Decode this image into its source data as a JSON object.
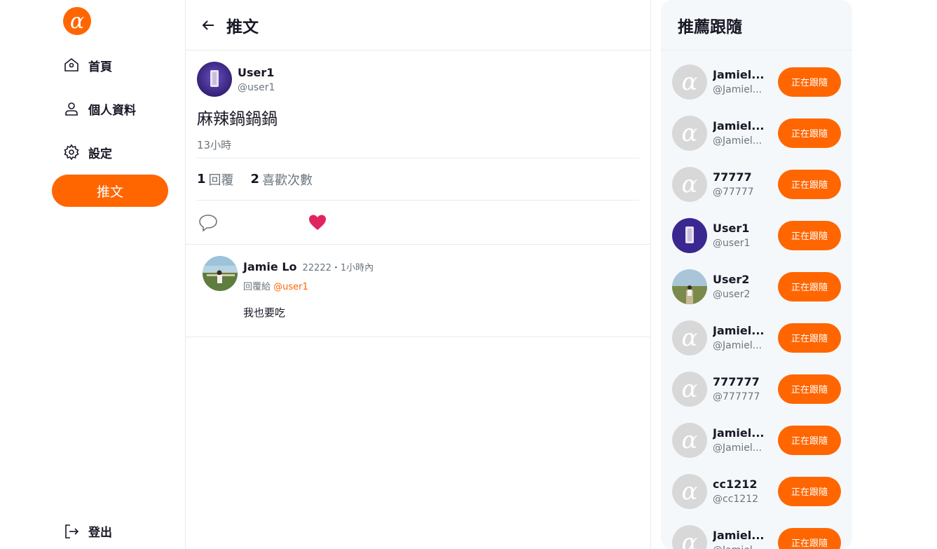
{
  "colors": {
    "brand": "#ff6600",
    "muted": "#6c757d",
    "like": "#e0245e"
  },
  "sidebar": {
    "logo": "alpha-logo",
    "items": [
      {
        "label": "首頁",
        "icon": "home-icon"
      },
      {
        "label": "個人資料",
        "icon": "user-icon"
      },
      {
        "label": "設定",
        "icon": "gear-icon"
      }
    ],
    "tweet_button": "推文",
    "logout": "登出"
  },
  "main": {
    "title": "推文",
    "tweet": {
      "name": "User1",
      "handle": "@user1",
      "text": "麻辣鍋鍋鍋",
      "time": "13小時",
      "reply_count": "1",
      "reply_label": "回覆",
      "like_count": "2",
      "like_label": "喜歡次數"
    },
    "reply": {
      "name": "Jamie Lo",
      "meta": "22222・1小時內",
      "reply_to_label": "回覆給",
      "reply_to_handle": "@user1",
      "text": "我也要吃"
    }
  },
  "right": {
    "title": "推薦跟隨",
    "follow_label": "正在跟隨",
    "users": [
      {
        "name": "Jamiel...",
        "handle": "@Jamiel...",
        "avatar": "default"
      },
      {
        "name": "Jamiel...",
        "handle": "@Jamiel...",
        "avatar": "default"
      },
      {
        "name": "77777",
        "handle": "@77777",
        "avatar": "default"
      },
      {
        "name": "User1",
        "handle": "@user1",
        "avatar": "purple"
      },
      {
        "name": "User2",
        "handle": "@user2",
        "avatar": "photo"
      },
      {
        "name": "Jamiel...",
        "handle": "@Jamiel...",
        "avatar": "default"
      },
      {
        "name": "777777",
        "handle": "@777777",
        "avatar": "default"
      },
      {
        "name": "Jamiel...",
        "handle": "@Jamiel...",
        "avatar": "default"
      },
      {
        "name": "cc1212",
        "handle": "@cc1212",
        "avatar": "default"
      },
      {
        "name": "Jamiel...",
        "handle": "@Jamiel...",
        "avatar": "default"
      }
    ]
  }
}
